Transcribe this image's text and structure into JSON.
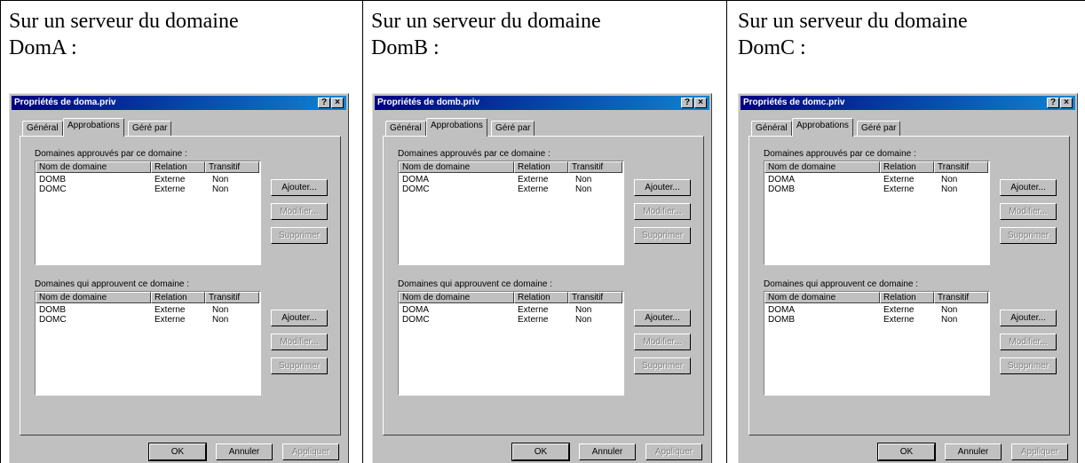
{
  "domains": [
    {
      "caption_line1": "Sur un serveur du domaine",
      "caption_line2": "DomA :",
      "window_title": "Propriétés de doma.priv",
      "help_button": "?",
      "close_button": "×",
      "tabs": [
        "Général",
        "Approbations",
        "Géré par"
      ],
      "approved_label": "Domaines approuvés par ce domaine :",
      "approving_label": "Domaines qui approuvent ce domaine :",
      "columns": [
        "Nom de domaine",
        "Relation",
        "Transitif"
      ],
      "approved_rows": [
        [
          "DOMB",
          "Externe",
          "Non"
        ],
        [
          "DOMC",
          "Externe",
          "Non"
        ]
      ],
      "approving_rows": [
        [
          "DOMB",
          "Externe",
          "Non"
        ],
        [
          "DOMC",
          "Externe",
          "Non"
        ]
      ],
      "add": "Ajouter...",
      "modify": "Modifier...",
      "delete": "Supprimer",
      "ok": "OK",
      "cancel": "Annuler",
      "apply": "Appliquer"
    },
    {
      "caption_line1": "Sur un serveur du domaine",
      "caption_line2": "DomB :",
      "window_title": "Propriétés de domb.priv",
      "help_button": "?",
      "close_button": "×",
      "tabs": [
        "Général",
        "Approbations",
        "Géré par"
      ],
      "approved_label": "Domaines approuvés par ce domaine :",
      "approving_label": "Domaines qui approuvent ce domaine :",
      "columns": [
        "Nom de domaine",
        "Relation",
        "Transitif"
      ],
      "approved_rows": [
        [
          "DOMA",
          "Externe",
          "Non"
        ],
        [
          "DOMC",
          "Externe",
          "Non"
        ]
      ],
      "approving_rows": [
        [
          "DOMA",
          "Externe",
          "Non"
        ],
        [
          "DOMC",
          "Externe",
          "Non"
        ]
      ],
      "add": "Ajouter...",
      "modify": "Modifier...",
      "delete": "Supprimer",
      "ok": "OK",
      "cancel": "Annuler",
      "apply": "Appliquer"
    },
    {
      "caption_line1": "Sur un serveur du domaine",
      "caption_line2": "DomC :",
      "window_title": "Propriétés de domc.priv",
      "help_button": "?",
      "close_button": "×",
      "tabs": [
        "Général",
        "Approbations",
        "Géré par"
      ],
      "approved_label": "Domaines approuvés par ce domaine :",
      "approving_label": "Domaines qui approuvent ce domaine :",
      "columns": [
        "Nom de domaine",
        "Relation",
        "Transitif"
      ],
      "approved_rows": [
        [
          "DOMA",
          "Externe",
          "Non"
        ],
        [
          "DOMB",
          "Externe",
          "Non"
        ]
      ],
      "approving_rows": [
        [
          "DOMA",
          "Externe",
          "Non"
        ],
        [
          "DOMB",
          "Externe",
          "Non"
        ]
      ],
      "add": "Ajouter...",
      "modify": "Modifier...",
      "delete": "Supprimer",
      "ok": "OK",
      "cancel": "Annuler",
      "apply": "Appliquer"
    }
  ]
}
